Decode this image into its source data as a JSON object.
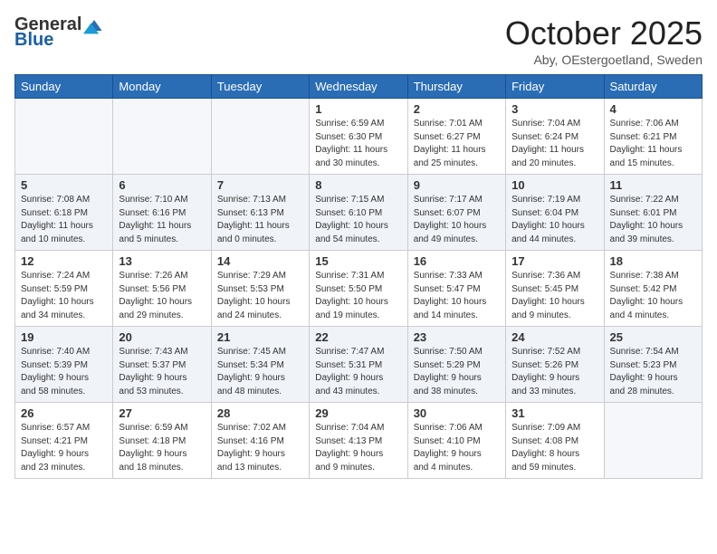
{
  "logo": {
    "general": "General",
    "blue": "Blue"
  },
  "title": {
    "month": "October 2025",
    "location": "Aby, OEstergoetland, Sweden"
  },
  "weekdays": [
    "Sunday",
    "Monday",
    "Tuesday",
    "Wednesday",
    "Thursday",
    "Friday",
    "Saturday"
  ],
  "weeks": [
    [
      {
        "day": "",
        "info": ""
      },
      {
        "day": "",
        "info": ""
      },
      {
        "day": "",
        "info": ""
      },
      {
        "day": "1",
        "info": "Sunrise: 6:59 AM\nSunset: 6:30 PM\nDaylight: 11 hours\nand 30 minutes."
      },
      {
        "day": "2",
        "info": "Sunrise: 7:01 AM\nSunset: 6:27 PM\nDaylight: 11 hours\nand 25 minutes."
      },
      {
        "day": "3",
        "info": "Sunrise: 7:04 AM\nSunset: 6:24 PM\nDaylight: 11 hours\nand 20 minutes."
      },
      {
        "day": "4",
        "info": "Sunrise: 7:06 AM\nSunset: 6:21 PM\nDaylight: 11 hours\nand 15 minutes."
      }
    ],
    [
      {
        "day": "5",
        "info": "Sunrise: 7:08 AM\nSunset: 6:18 PM\nDaylight: 11 hours\nand 10 minutes."
      },
      {
        "day": "6",
        "info": "Sunrise: 7:10 AM\nSunset: 6:16 PM\nDaylight: 11 hours\nand 5 minutes."
      },
      {
        "day": "7",
        "info": "Sunrise: 7:13 AM\nSunset: 6:13 PM\nDaylight: 11 hours\nand 0 minutes."
      },
      {
        "day": "8",
        "info": "Sunrise: 7:15 AM\nSunset: 6:10 PM\nDaylight: 10 hours\nand 54 minutes."
      },
      {
        "day": "9",
        "info": "Sunrise: 7:17 AM\nSunset: 6:07 PM\nDaylight: 10 hours\nand 49 minutes."
      },
      {
        "day": "10",
        "info": "Sunrise: 7:19 AM\nSunset: 6:04 PM\nDaylight: 10 hours\nand 44 minutes."
      },
      {
        "day": "11",
        "info": "Sunrise: 7:22 AM\nSunset: 6:01 PM\nDaylight: 10 hours\nand 39 minutes."
      }
    ],
    [
      {
        "day": "12",
        "info": "Sunrise: 7:24 AM\nSunset: 5:59 PM\nDaylight: 10 hours\nand 34 minutes."
      },
      {
        "day": "13",
        "info": "Sunrise: 7:26 AM\nSunset: 5:56 PM\nDaylight: 10 hours\nand 29 minutes."
      },
      {
        "day": "14",
        "info": "Sunrise: 7:29 AM\nSunset: 5:53 PM\nDaylight: 10 hours\nand 24 minutes."
      },
      {
        "day": "15",
        "info": "Sunrise: 7:31 AM\nSunset: 5:50 PM\nDaylight: 10 hours\nand 19 minutes."
      },
      {
        "day": "16",
        "info": "Sunrise: 7:33 AM\nSunset: 5:47 PM\nDaylight: 10 hours\nand 14 minutes."
      },
      {
        "day": "17",
        "info": "Sunrise: 7:36 AM\nSunset: 5:45 PM\nDaylight: 10 hours\nand 9 minutes."
      },
      {
        "day": "18",
        "info": "Sunrise: 7:38 AM\nSunset: 5:42 PM\nDaylight: 10 hours\nand 4 minutes."
      }
    ],
    [
      {
        "day": "19",
        "info": "Sunrise: 7:40 AM\nSunset: 5:39 PM\nDaylight: 9 hours\nand 58 minutes."
      },
      {
        "day": "20",
        "info": "Sunrise: 7:43 AM\nSunset: 5:37 PM\nDaylight: 9 hours\nand 53 minutes."
      },
      {
        "day": "21",
        "info": "Sunrise: 7:45 AM\nSunset: 5:34 PM\nDaylight: 9 hours\nand 48 minutes."
      },
      {
        "day": "22",
        "info": "Sunrise: 7:47 AM\nSunset: 5:31 PM\nDaylight: 9 hours\nand 43 minutes."
      },
      {
        "day": "23",
        "info": "Sunrise: 7:50 AM\nSunset: 5:29 PM\nDaylight: 9 hours\nand 38 minutes."
      },
      {
        "day": "24",
        "info": "Sunrise: 7:52 AM\nSunset: 5:26 PM\nDaylight: 9 hours\nand 33 minutes."
      },
      {
        "day": "25",
        "info": "Sunrise: 7:54 AM\nSunset: 5:23 PM\nDaylight: 9 hours\nand 28 minutes."
      }
    ],
    [
      {
        "day": "26",
        "info": "Sunrise: 6:57 AM\nSunset: 4:21 PM\nDaylight: 9 hours\nand 23 minutes."
      },
      {
        "day": "27",
        "info": "Sunrise: 6:59 AM\nSunset: 4:18 PM\nDaylight: 9 hours\nand 18 minutes."
      },
      {
        "day": "28",
        "info": "Sunrise: 7:02 AM\nSunset: 4:16 PM\nDaylight: 9 hours\nand 13 minutes."
      },
      {
        "day": "29",
        "info": "Sunrise: 7:04 AM\nSunset: 4:13 PM\nDaylight: 9 hours\nand 9 minutes."
      },
      {
        "day": "30",
        "info": "Sunrise: 7:06 AM\nSunset: 4:10 PM\nDaylight: 9 hours\nand 4 minutes."
      },
      {
        "day": "31",
        "info": "Sunrise: 7:09 AM\nSunset: 4:08 PM\nDaylight: 8 hours\nand 59 minutes."
      },
      {
        "day": "",
        "info": ""
      }
    ]
  ]
}
